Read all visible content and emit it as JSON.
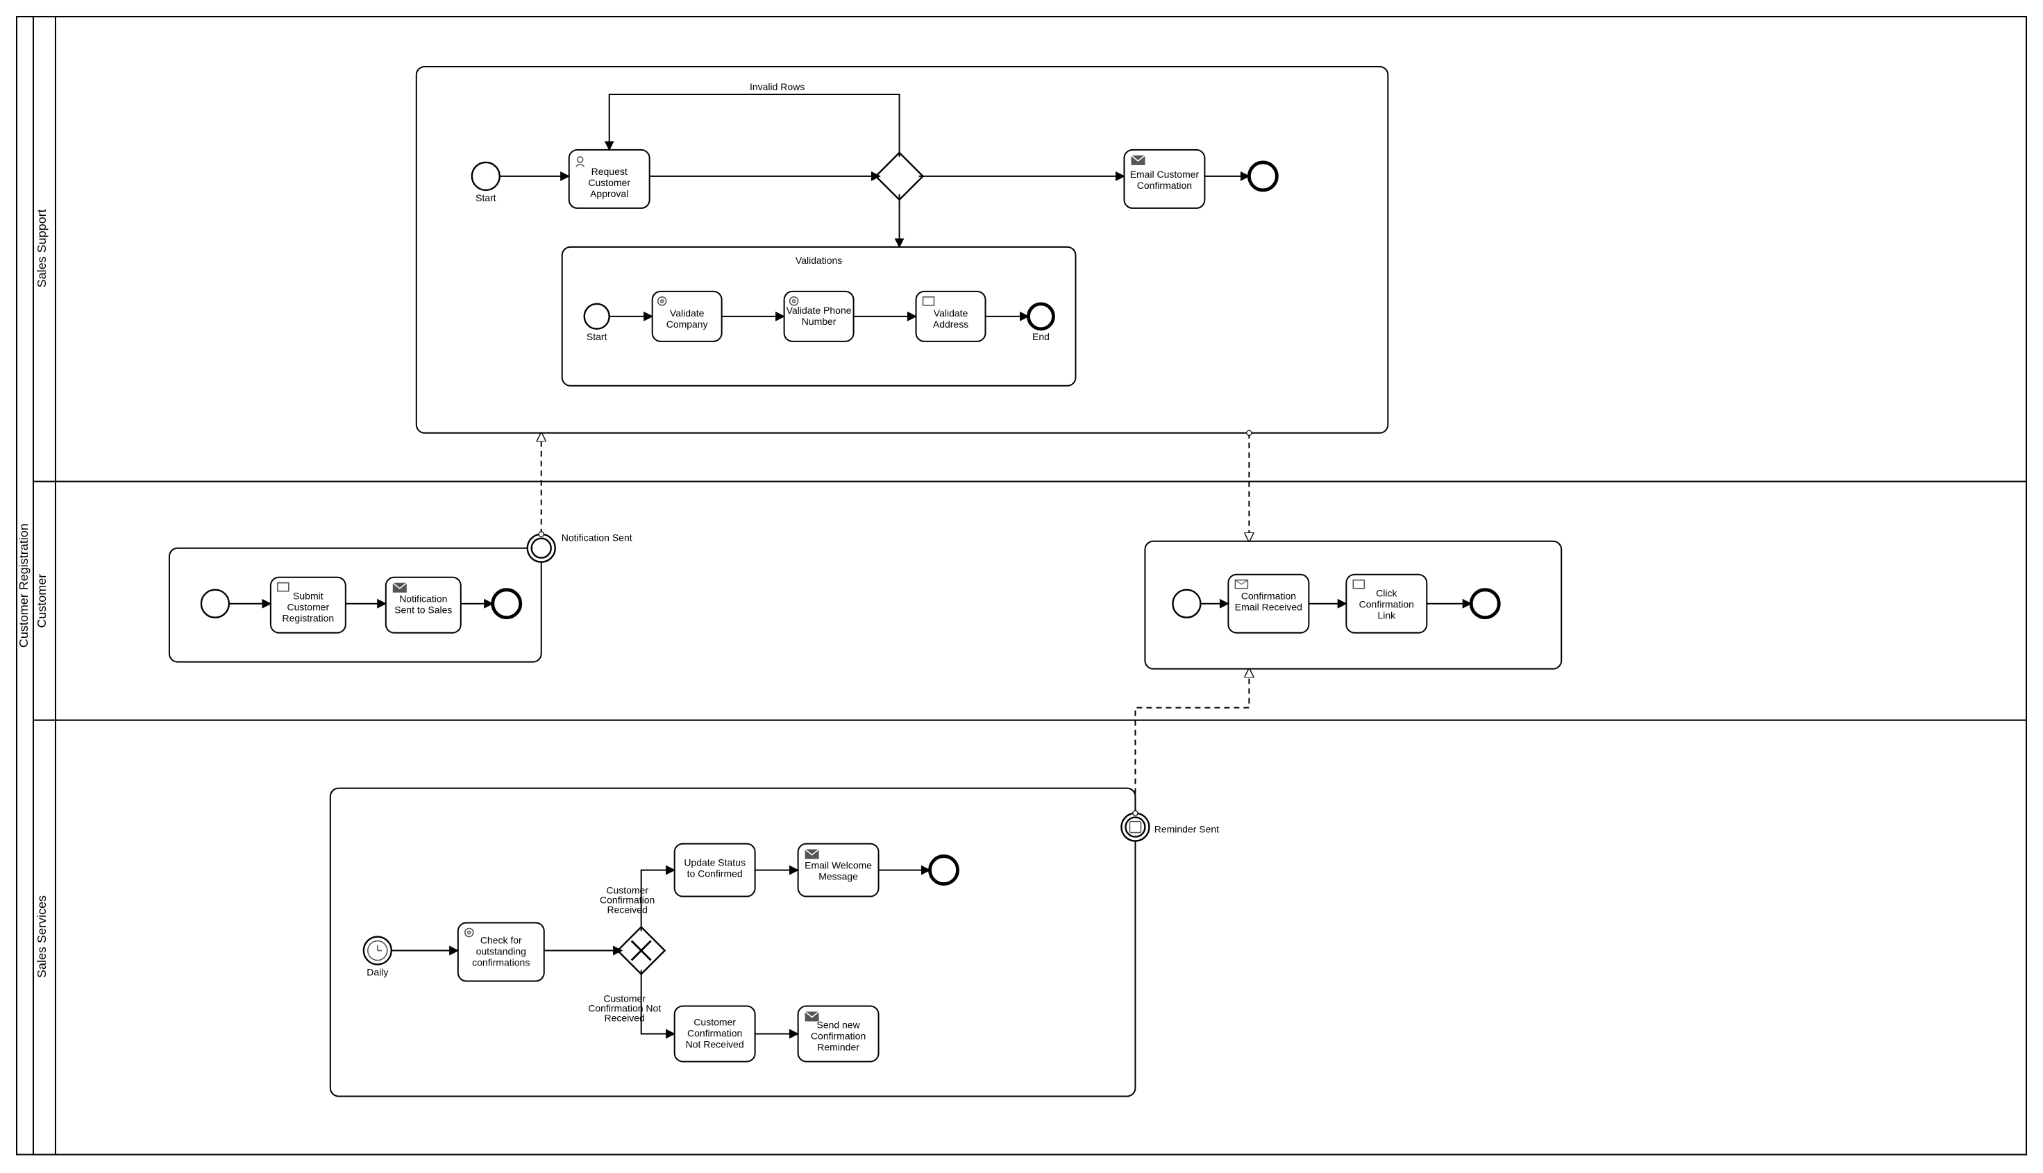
{
  "pool": {
    "label": "Customer Registration"
  },
  "lanes": {
    "salesSupport": {
      "label": "Sales Support"
    },
    "customer": {
      "label": "Customer"
    },
    "salesServices": {
      "label": "Sales Services"
    }
  },
  "events": {
    "ss_start": {
      "label": "Start"
    },
    "ss_end": {
      "label": ""
    },
    "val_start": {
      "label": "Start"
    },
    "val_end": {
      "label": "End"
    },
    "cust1_start": {
      "label": ""
    },
    "cust1_end": {
      "label": ""
    },
    "cust1_boundary": {
      "label": "Notification Sent"
    },
    "cust2_start": {
      "label": ""
    },
    "cust2_end": {
      "label": ""
    },
    "sv_start": {
      "label": "Daily"
    },
    "sv_end": {
      "label": ""
    },
    "sv_boundary": {
      "label": "Reminder Sent"
    }
  },
  "tasks": {
    "reqApproval": {
      "label": "Request Customer Approval"
    },
    "emailConfirm": {
      "label": "Email Customer Confirmation"
    },
    "valCompany": {
      "label": "Validate Company"
    },
    "valPhone": {
      "label": "Validate Phone Number"
    },
    "valAddress": {
      "label": "Validate Address"
    },
    "submitReg": {
      "label": "Submit Customer Registration"
    },
    "notifSent": {
      "label": "Notification Sent to Sales"
    },
    "confEmailRecv": {
      "label": "Confirmation Email Received"
    },
    "clickLink": {
      "label": "Click Confirmation Link"
    },
    "checkOutstanding": {
      "label": "Check for outstanding confirmations"
    },
    "updateStatus": {
      "label": "Update Status to Confirmed"
    },
    "welcomeMsg": {
      "label": "Email Welcome Message"
    },
    "confNotRecv": {
      "label": "Customer Confirmation Not Received"
    },
    "sendReminder": {
      "label": "Send new Confirmation Reminder"
    }
  },
  "subprocesses": {
    "validations": {
      "label": "Validations"
    }
  },
  "edgeLabels": {
    "invalidRows": "Invalid Rows",
    "confRecv": "Customer Confirmation Received",
    "confNotRecv": "Customer Confirmation Not Received"
  }
}
